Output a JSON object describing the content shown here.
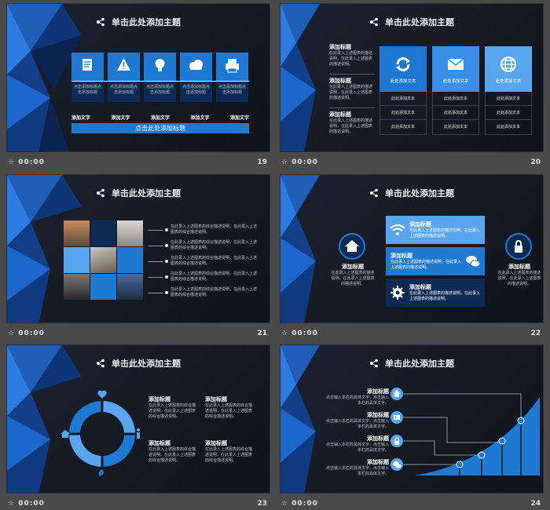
{
  "title": "单击此处添加主题",
  "time": "00:00",
  "colors": {
    "accent": "#1f78d1",
    "light_accent": "#5aa6ee",
    "bg": "#161b25"
  },
  "slides": [
    {
      "num": "19",
      "icons": [
        "document-icon",
        "warning-icon",
        "bulb-icon",
        "cloud-icon",
        "printer-icon"
      ],
      "box_text": "点击添加标题点击添加标题",
      "labels": [
        "添加文字",
        "添加文字",
        "添加文字",
        "添加文字",
        "添加文字"
      ],
      "bar": "点击此处添加标题"
    },
    {
      "num": "20",
      "left": [
        {
          "heading": "添加标题",
          "text": "在此录入上述图表的描述说明，在此录入上述图表的描述说明。"
        },
        {
          "heading": "添加标题",
          "text": "在此录入上述图表的描述说明，在此录入上述图表的描述说明。"
        },
        {
          "heading": "添加标题",
          "text": "在此录入上述图表的描述说明，在此录入上述图表的描述说明。"
        }
      ],
      "cards": [
        {
          "icon": "refresh-icon",
          "label": "此处添加文本"
        },
        {
          "icon": "mail-icon",
          "label": "此处添加文本"
        },
        {
          "icon": "globe-icon",
          "label": "此处添加文本"
        }
      ],
      "row_text": "此处添加文本"
    },
    {
      "num": "21",
      "line_text": "在此录入上述图表的综合描述说明，在此录入上述图表的综合描述说明。"
    },
    {
      "num": "22",
      "left": {
        "heading": "添加标题",
        "text": "在此录入上述图表的描述说明，在此录入上述图表的描述说明。"
      },
      "right": {
        "heading": "添加标题",
        "text": "在此录入上述图表的描述说明，在此录入上述图表的描述说明。"
      },
      "boxes": [
        {
          "heading": "添加标题",
          "text": "在此录入上述图表的描述说明，在此录入上述图表的描述说明。"
        },
        {
          "heading": "添加标题",
          "text": "在此录入上述图表的描述说明，在此录入上述图表的描述说明。"
        },
        {
          "heading": "添加标题",
          "text": "在此录入上述图表的描述说明，在此录入上述图表的描述说明。"
        }
      ]
    },
    {
      "num": "23",
      "blocks": [
        {
          "heading": "添加标题",
          "text": "在此录入上述图表的综合描述说明，在此录入上述图表的综合描述说明。"
        },
        {
          "heading": "添加标题",
          "text": "在此录入上述图表的综合描述说明，在此录入上述图表的综合描述说明。"
        },
        {
          "heading": "添加标题",
          "text": "在此录入上述图表的综合描述说明，在此录入上述图表的综合描述说明。"
        },
        {
          "heading": "添加标题",
          "text": "在此录入上述图表的综合描述说明，在此录入上述图表的综合描述说明。"
        }
      ]
    },
    {
      "num": "24",
      "items": [
        {
          "heading": "添加标题",
          "text": "点击输入本栏的具体文字，点击输入本栏的具体文字。"
        },
        {
          "heading": "添加标题",
          "text": "点击输入本栏的具体文字，点击输入本栏的具体文字。"
        },
        {
          "heading": "添加标题",
          "text": "点击输入本栏的具体文字，点击输入本栏的具体文字。"
        },
        {
          "heading": "添加标题",
          "text": "点击输入本栏的具体文字，点击输入本栏的具体文字。"
        }
      ],
      "icons": [
        "home-icon",
        "film-icon",
        "lock-icon",
        "chat-icon"
      ]
    }
  ]
}
